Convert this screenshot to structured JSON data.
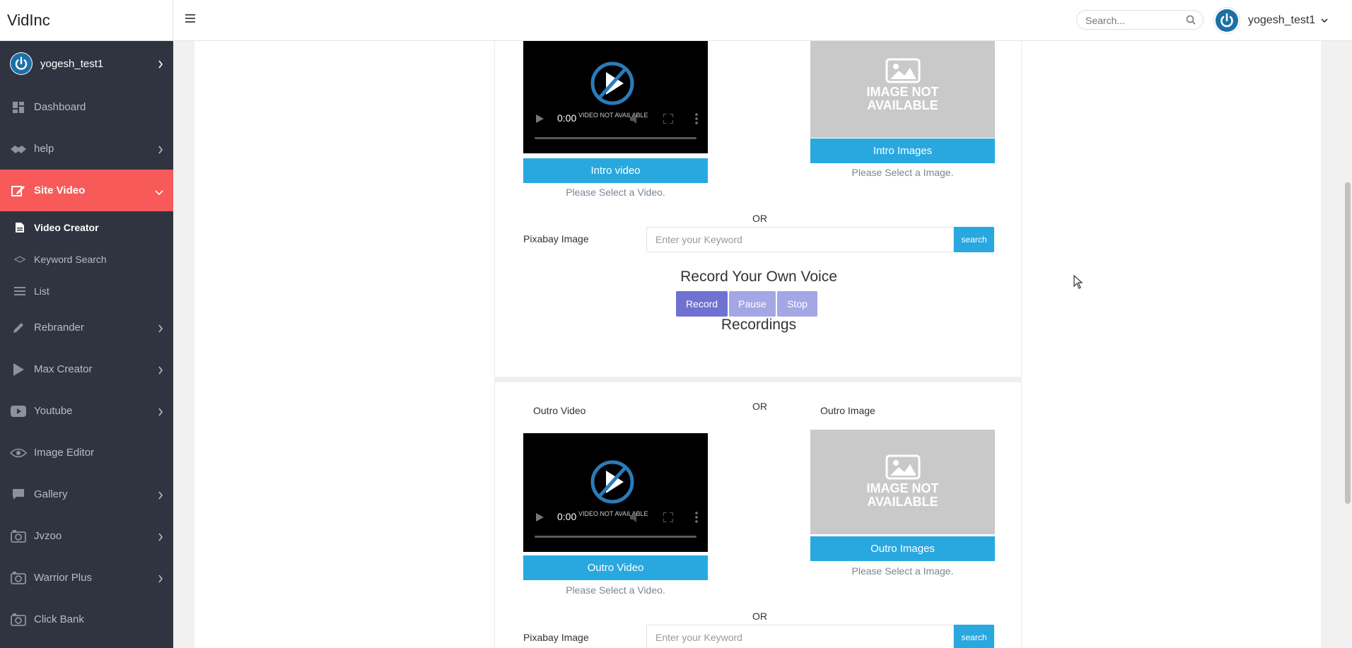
{
  "app": {
    "brand": "VidInc"
  },
  "header": {
    "search_placeholder": "Search...",
    "username": "yogesh_test1"
  },
  "sidebar": {
    "username": "yogesh_test1",
    "items": [
      {
        "label": "Dashboard"
      },
      {
        "label": "help"
      },
      {
        "label": "Site Video"
      },
      {
        "label": "Video Creator"
      },
      {
        "label": "Keyword Search"
      },
      {
        "label": "List"
      },
      {
        "label": "Rebrander"
      },
      {
        "label": "Max Creator"
      },
      {
        "label": "Youtube"
      },
      {
        "label": "Image Editor"
      },
      {
        "label": "Gallery"
      },
      {
        "label": "Jvzoo"
      },
      {
        "label": "Warrior Plus"
      },
      {
        "label": "Click Bank"
      }
    ]
  },
  "intro": {
    "video_time": "0:00",
    "video_unavailable": "VIDEO NOT AVAILABLE",
    "image_unavailable_line1": "IMAGE NOT",
    "image_unavailable_line2": "AVAILABLE",
    "video_button": "Intro video",
    "image_button": "Intro Images",
    "video_hint": "Please Select a Video.",
    "image_hint": "Please Select a Image.",
    "or": "OR",
    "pixabay_label": "Pixabay Image",
    "keyword_placeholder": "Enter your Keyword",
    "search_button": "search"
  },
  "voice": {
    "heading": "Record Your Own Voice",
    "record": "Record",
    "pause": "Pause",
    "stop": "Stop",
    "recordings": "Recordings"
  },
  "outro": {
    "video_label": "Outro Video",
    "image_label": "Outro Image",
    "or_top": "OR",
    "video_time": "0:00",
    "video_unavailable": "VIDEO NOT AVAILABLE",
    "image_unavailable_line1": "IMAGE NOT",
    "image_unavailable_line2": "AVAILABLE",
    "video_button": "Outro Video",
    "image_button": "Outro Images",
    "video_hint": "Please Select a Video.",
    "image_hint": "Please Select a Image.",
    "or": "OR",
    "pixabay_label": "Pixabay Image",
    "keyword_placeholder": "Enter your Keyword",
    "search_button": "search"
  },
  "colors": {
    "sidebar_bg": "#2f3440",
    "active_nav": "#f85a5a",
    "accent_blue": "#29a8e0",
    "record_btn": "#6f72d1",
    "record_btn_disabled": "#a4a7e4"
  }
}
